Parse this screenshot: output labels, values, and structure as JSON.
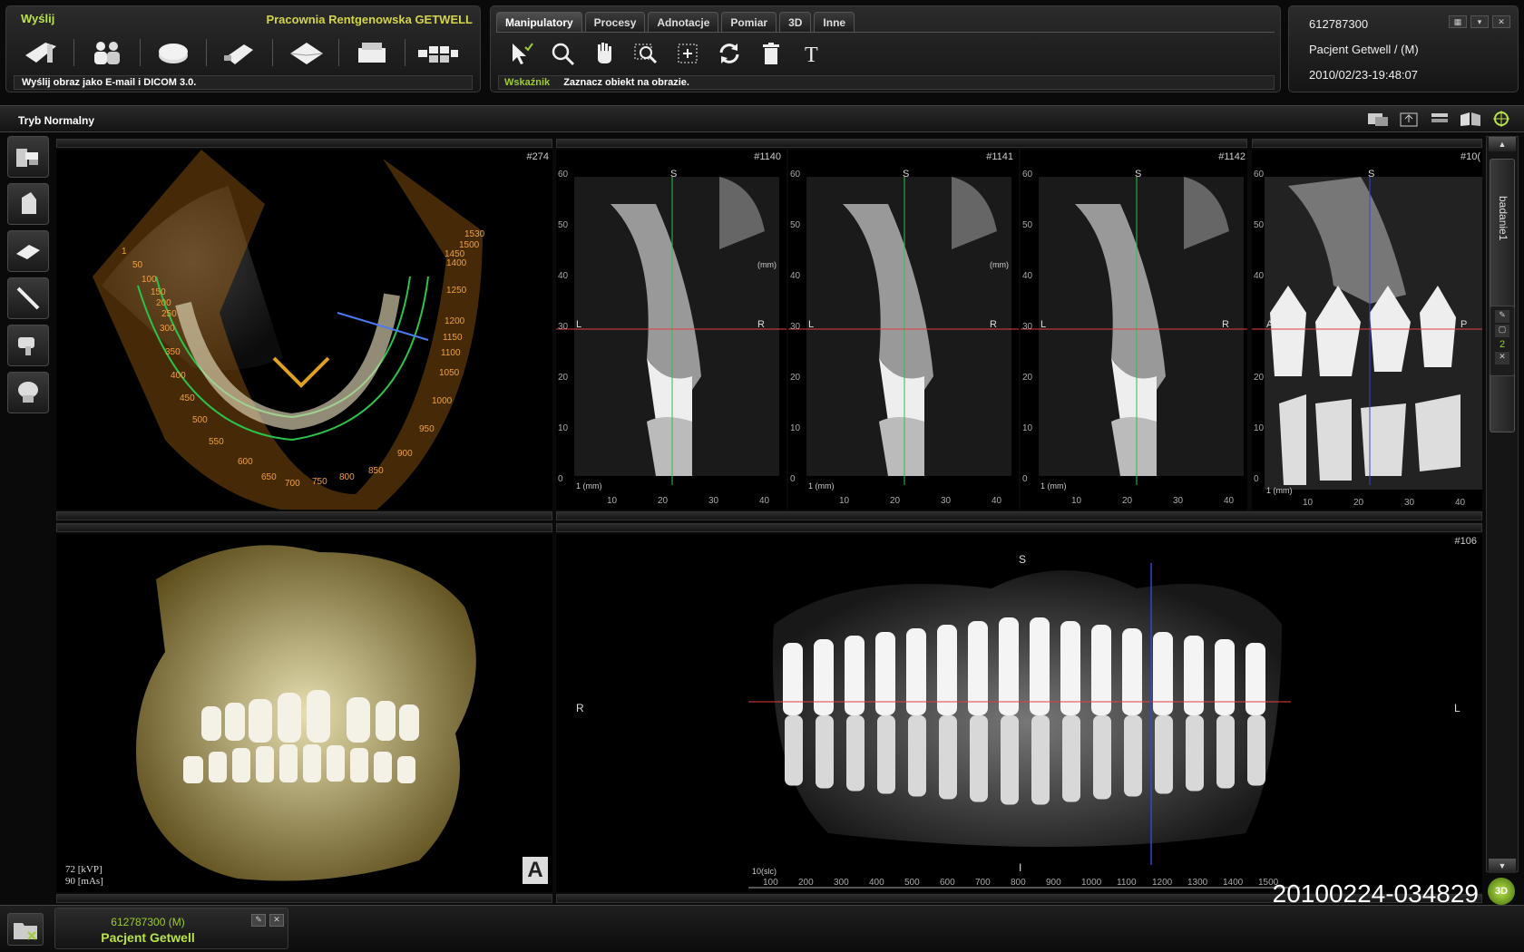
{
  "send_panel": {
    "title": "Wyślij",
    "studio": "Pracownia Rentgenowska GETWELL",
    "status": "Wyślij obraz jako E-mail i DICOM 3.0.",
    "icons": [
      "send-email-icon",
      "people-icon",
      "disc-icon",
      "usb-drive-icon",
      "envelope-icon",
      "printer-icon",
      "layout-grid-icon"
    ]
  },
  "tools_panel": {
    "tabs": [
      "Manipulatory",
      "Procesy",
      "Adnotacje",
      "Pomiar",
      "3D",
      "Inne"
    ],
    "active_tab": "Manipulatory",
    "tools": [
      "pointer-icon",
      "zoom-icon",
      "pan-hand-icon",
      "zoom-region-icon",
      "fit-icon",
      "reset-icon",
      "delete-icon",
      "text-icon"
    ],
    "status_label": "Wskaźnik",
    "status_text": "Zaznacz obiekt na obrazie."
  },
  "patient_panel": {
    "id": "612787300",
    "name": "Pacjent Getwell  /  (M)",
    "datetime": "2010/02/23-19:48:07"
  },
  "mode_bar": {
    "label": "Tryb Normalny"
  },
  "views": {
    "axial": {
      "slice": "#274",
      "numbers": [
        "1",
        "50",
        "100",
        "150",
        "200",
        "250",
        "300",
        "350",
        "400",
        "450",
        "500",
        "550",
        "600",
        "650",
        "700",
        "750",
        "800",
        "850",
        "900",
        "950",
        "1000",
        "1050",
        "1100",
        "1150",
        "1200",
        "1250",
        "1400",
        "1450",
        "1500",
        "1530"
      ]
    },
    "cross1": {
      "slice": "#1140"
    },
    "cross2": {
      "slice": "#1141"
    },
    "cross3": {
      "slice": "#1142"
    },
    "sagittal": {
      "slice": "#10(",
      "ant": "A",
      "post": "P"
    },
    "pano": {
      "slice": "#106",
      "top": "S",
      "bottom": "I",
      "left": "R",
      "right": "L",
      "ruler_start": "10(slc)",
      "ruler": [
        "100",
        "200",
        "300",
        "400",
        "500",
        "600",
        "700",
        "800",
        "900",
        "1000",
        "1100",
        "1200",
        "1300",
        "1400",
        "1500"
      ]
    },
    "render": {
      "kvp": "72 [kVP]",
      "mas": "90 [mAs]",
      "orient": "A"
    },
    "cross_labels": {
      "top": "S",
      "left": "L",
      "right": "R",
      "mm": "(mm)",
      "unit": "1 (mm)",
      "xticks": [
        "10",
        "20",
        "30",
        "40"
      ],
      "yticks": [
        "60",
        "50",
        "40",
        "30",
        "20",
        "10",
        "0"
      ]
    }
  },
  "right_tab": {
    "label": "badanie1",
    "count": "2"
  },
  "footer": {
    "patient_id": "612787300 (M)",
    "patient_name": "Pacjent Getwell",
    "study_id": "20100224-034829"
  }
}
